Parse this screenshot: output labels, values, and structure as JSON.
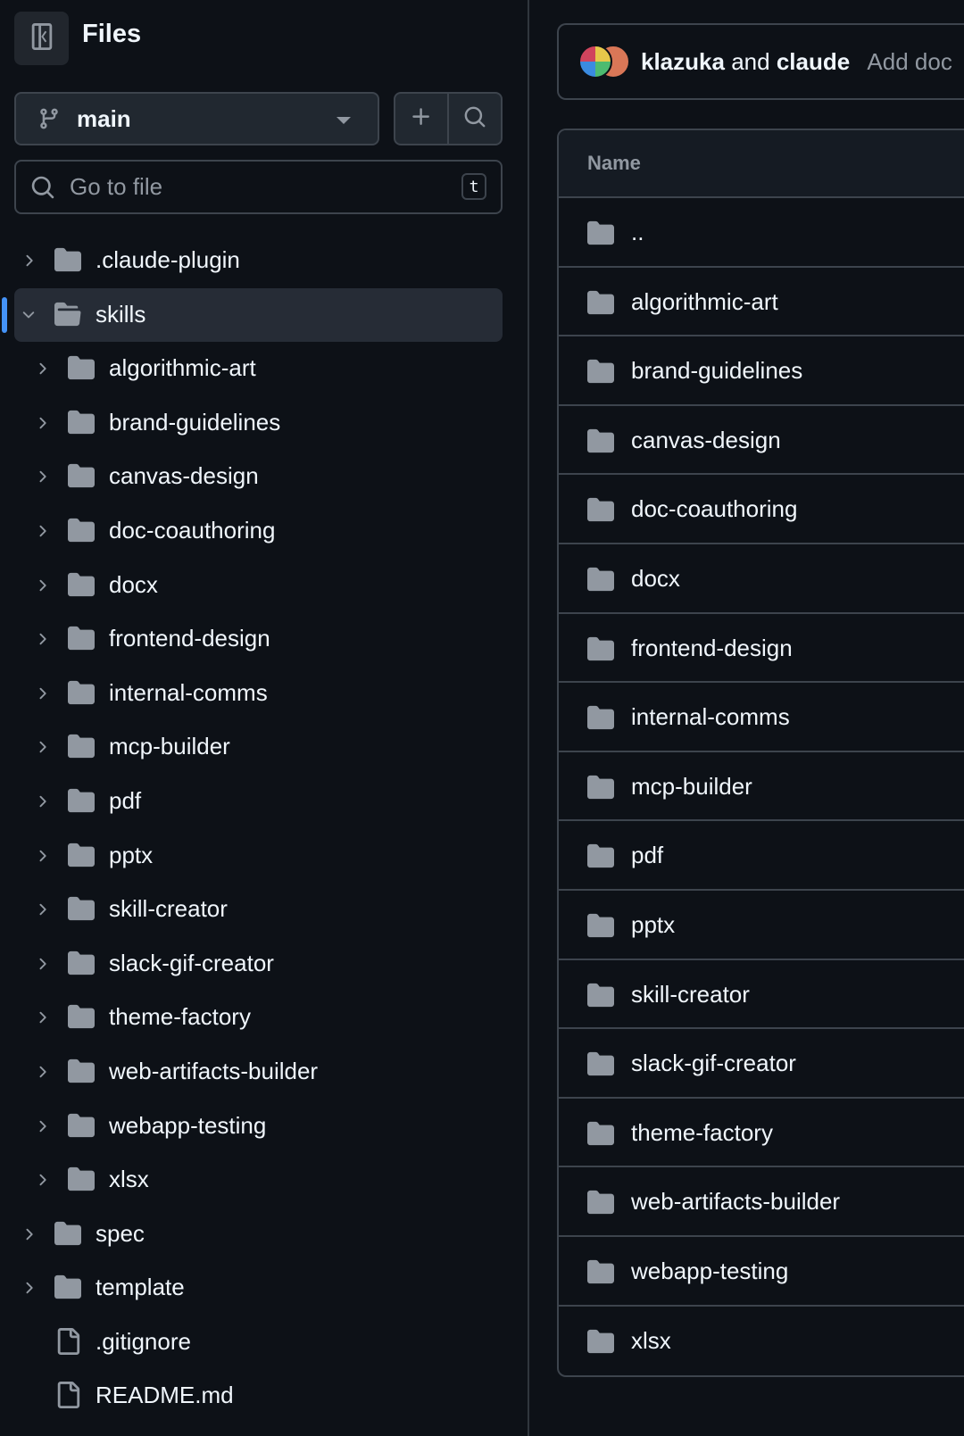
{
  "sidebar": {
    "title": "Files",
    "branch": "main",
    "search": {
      "placeholder": "Go to file",
      "shortcut": "t"
    },
    "tree": [
      {
        "label": ".claude-plugin",
        "type": "folder",
        "level": 0,
        "expanded": false,
        "selected": false
      },
      {
        "label": "skills",
        "type": "folder",
        "level": 0,
        "expanded": true,
        "selected": true
      },
      {
        "label": "algorithmic-art",
        "type": "folder",
        "level": 1,
        "expanded": false,
        "selected": false
      },
      {
        "label": "brand-guidelines",
        "type": "folder",
        "level": 1,
        "expanded": false,
        "selected": false
      },
      {
        "label": "canvas-design",
        "type": "folder",
        "level": 1,
        "expanded": false,
        "selected": false
      },
      {
        "label": "doc-coauthoring",
        "type": "folder",
        "level": 1,
        "expanded": false,
        "selected": false
      },
      {
        "label": "docx",
        "type": "folder",
        "level": 1,
        "expanded": false,
        "selected": false
      },
      {
        "label": "frontend-design",
        "type": "folder",
        "level": 1,
        "expanded": false,
        "selected": false
      },
      {
        "label": "internal-comms",
        "type": "folder",
        "level": 1,
        "expanded": false,
        "selected": false
      },
      {
        "label": "mcp-builder",
        "type": "folder",
        "level": 1,
        "expanded": false,
        "selected": false
      },
      {
        "label": "pdf",
        "type": "folder",
        "level": 1,
        "expanded": false,
        "selected": false
      },
      {
        "label": "pptx",
        "type": "folder",
        "level": 1,
        "expanded": false,
        "selected": false
      },
      {
        "label": "skill-creator",
        "type": "folder",
        "level": 1,
        "expanded": false,
        "selected": false
      },
      {
        "label": "slack-gif-creator",
        "type": "folder",
        "level": 1,
        "expanded": false,
        "selected": false
      },
      {
        "label": "theme-factory",
        "type": "folder",
        "level": 1,
        "expanded": false,
        "selected": false
      },
      {
        "label": "web-artifacts-builder",
        "type": "folder",
        "level": 1,
        "expanded": false,
        "selected": false
      },
      {
        "label": "webapp-testing",
        "type": "folder",
        "level": 1,
        "expanded": false,
        "selected": false
      },
      {
        "label": "xlsx",
        "type": "folder",
        "level": 1,
        "expanded": false,
        "selected": false
      },
      {
        "label": "spec",
        "type": "folder",
        "level": 0,
        "expanded": false,
        "selected": false
      },
      {
        "label": "template",
        "type": "folder",
        "level": 0,
        "expanded": false,
        "selected": false
      },
      {
        "label": ".gitignore",
        "type": "file",
        "level": 0,
        "expanded": false,
        "selected": false
      },
      {
        "label": "README.md",
        "type": "file",
        "level": 0,
        "expanded": false,
        "selected": false
      }
    ]
  },
  "commit": {
    "author1": "klazuka",
    "conjunction": "and",
    "author2": "claude",
    "message": "Add doc"
  },
  "table": {
    "header": "Name",
    "rows": [
      "..",
      "algorithmic-art",
      "brand-guidelines",
      "canvas-design",
      "doc-coauthoring",
      "docx",
      "frontend-design",
      "internal-comms",
      "mcp-builder",
      "pdf",
      "pptx",
      "skill-creator",
      "slack-gif-creator",
      "theme-factory",
      "web-artifacts-builder",
      "webapp-testing",
      "xlsx"
    ]
  },
  "colors": {
    "background": "#0d1117",
    "border": "#3d444d",
    "accent": "#4493f8",
    "icon": "#9198a1",
    "selected_bg": "#262c36"
  },
  "icons": {
    "sidebar_toggle": "sidebar-collapse-icon",
    "branch": "git-branch-icon",
    "add": "plus-icon",
    "search": "search-icon",
    "folder": "folder-icon",
    "folder_open": "folder-open-icon",
    "file": "file-icon",
    "chevron_right": "chevron-right-icon",
    "chevron_down": "chevron-down-icon"
  }
}
